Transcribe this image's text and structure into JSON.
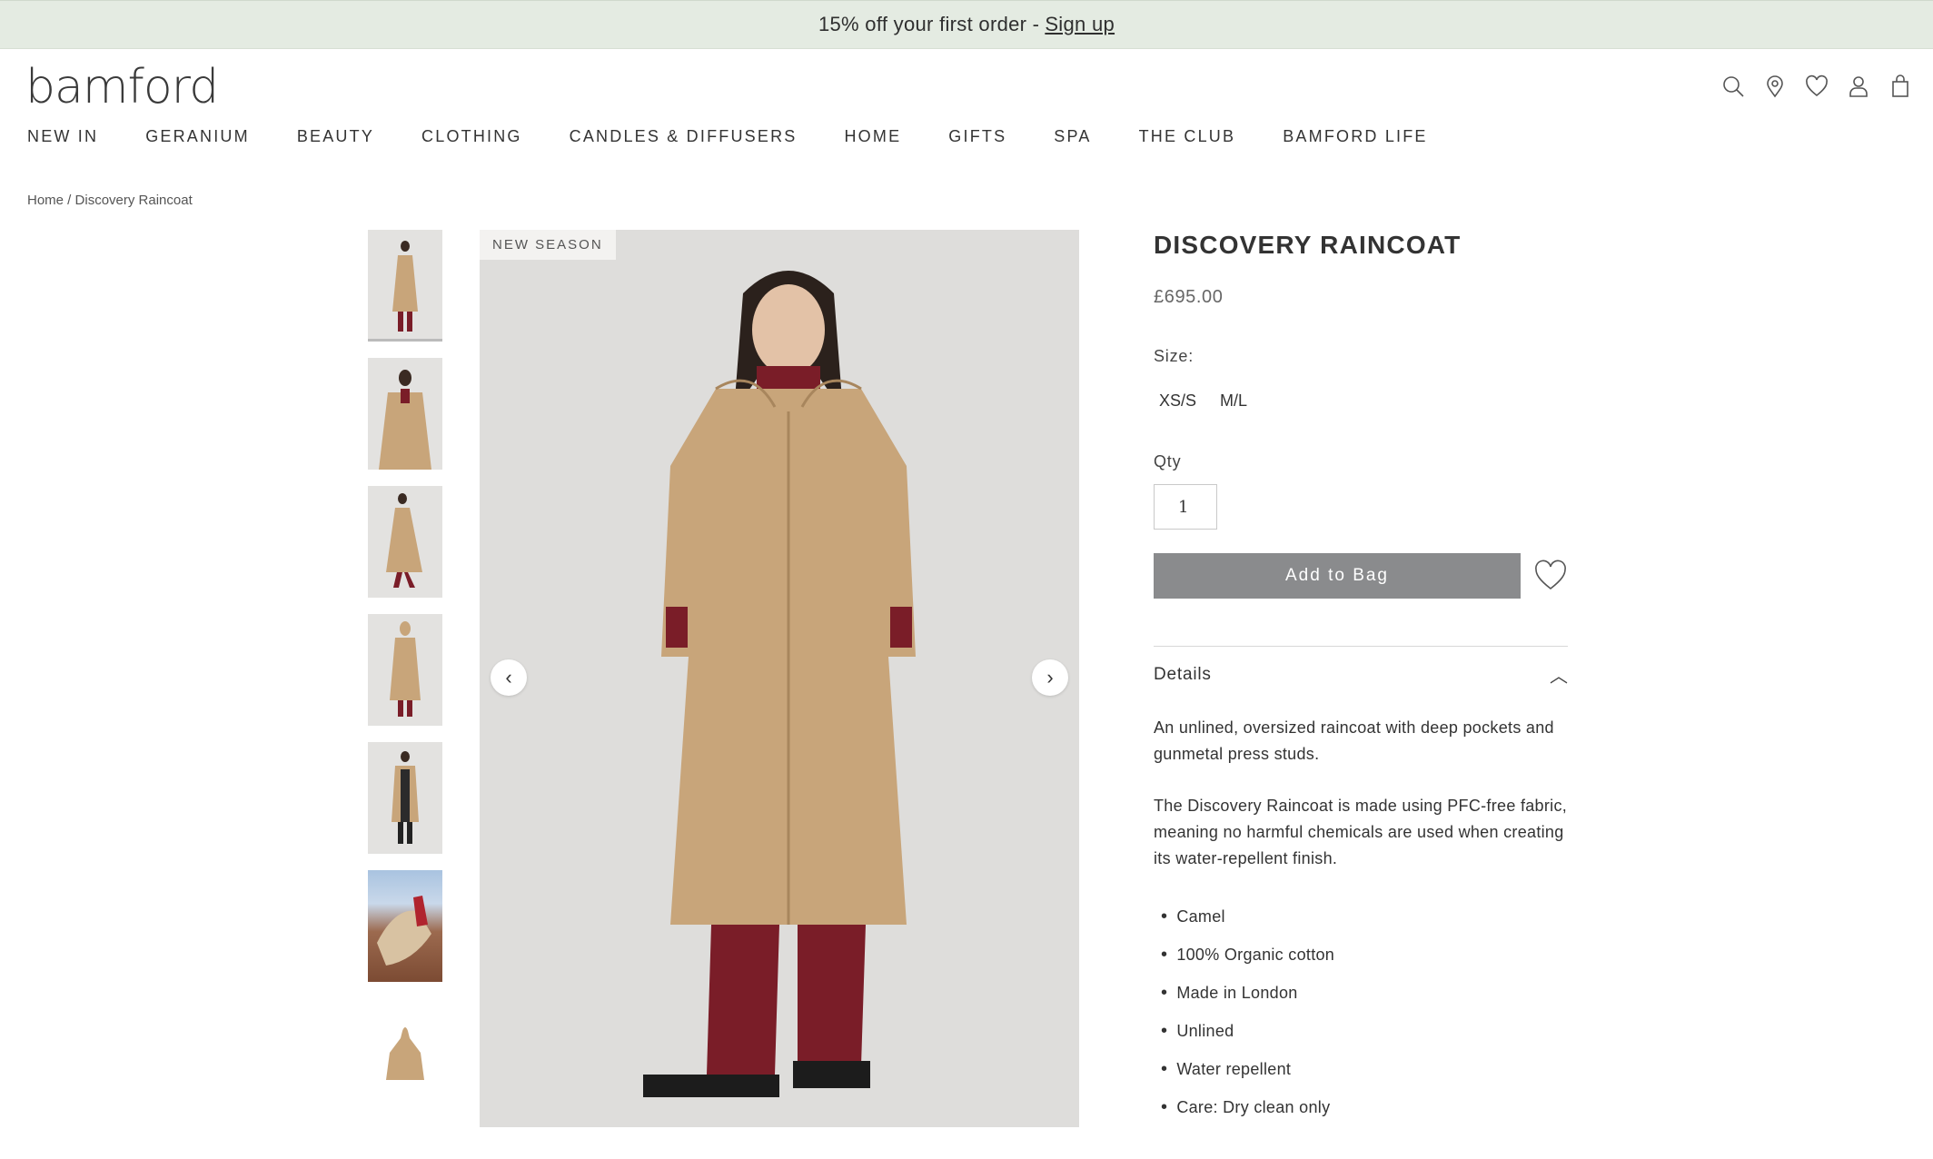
{
  "promo": {
    "text": "15% off your first order -",
    "link": " Sign up"
  },
  "logo": {
    "text": "bamford"
  },
  "header_icons": [
    "search-icon",
    "location-pin-icon",
    "heart-icon",
    "account-icon",
    "bag-icon"
  ],
  "nav": {
    "items": [
      "NEW IN",
      "GERANIUM",
      "BEAUTY",
      "CLOTHING",
      "CANDLES & DIFFUSERS",
      "HOME",
      "GIFTS",
      "SPA",
      "THE CLUB",
      "BAMFORD LIFE"
    ]
  },
  "breadcrumb": {
    "home": "Home",
    "separator": " / ",
    "current": "Discovery Raincoat"
  },
  "gallery": {
    "badge": "NEW SEASON",
    "prev_icon": "‹",
    "next_icon": "›",
    "thumb_count": 7
  },
  "product": {
    "title": "DISCOVERY RAINCOAT",
    "price": "£695.00",
    "size_label": "Size:",
    "sizes": [
      "XS/S",
      "M/L"
    ],
    "qty_label": "Qty",
    "qty_value": "1",
    "add_to_bag": "Add to Bag",
    "details_label": "Details",
    "description": [
      "An unlined, oversized raincoat with deep pockets and gunmetal press studs.",
      "The Discovery Raincoat is made using PFC-free fabric, meaning no harmful chemicals are used when creating its water-repellent finish."
    ],
    "features": [
      "Camel",
      "100% Organic cotton",
      "Made in London",
      "Unlined",
      "Water repellent",
      "Care: Dry clean only"
    ]
  },
  "colors": {
    "promo_bg": "#e4ebe2",
    "button_bg": "#8a8b8d",
    "coat": "#c8a57a",
    "trousers": "#7a1d28"
  }
}
